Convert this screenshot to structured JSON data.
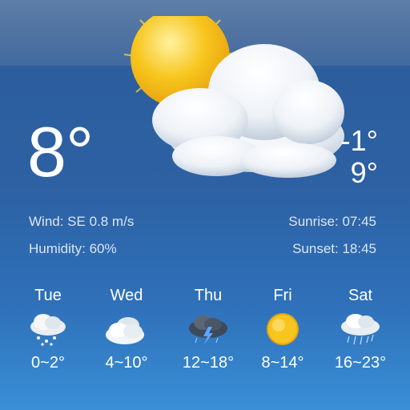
{
  "current": {
    "temperature": "8°",
    "condition_icon": "partly-cloudy-icon",
    "low": "-1°",
    "high": "9°"
  },
  "details": {
    "wind": "Wind: SE 0.8 m/s",
    "humidity": "Humidity: 60%",
    "sunrise": "Sunrise: 07:45",
    "sunset": "Sunset: 18:45"
  },
  "forecast": [
    {
      "day": "Tue",
      "icon": "snow-cloud-icon",
      "range": "0~2°"
    },
    {
      "day": "Wed",
      "icon": "cloudy-icon",
      "range": "4~10°"
    },
    {
      "day": "Thu",
      "icon": "thunderstorm-icon",
      "range": "12~18°"
    },
    {
      "day": "Fri",
      "icon": "sunny-icon",
      "range": "8~14°"
    },
    {
      "day": "Sat",
      "icon": "rain-cloud-icon",
      "range": "16~23°"
    }
  ],
  "colors": {
    "background_top": "#4f72a1",
    "background_bottom": "#3a8fd6",
    "sun": "#f7c51d",
    "text_secondary": "#dbe6f2"
  }
}
